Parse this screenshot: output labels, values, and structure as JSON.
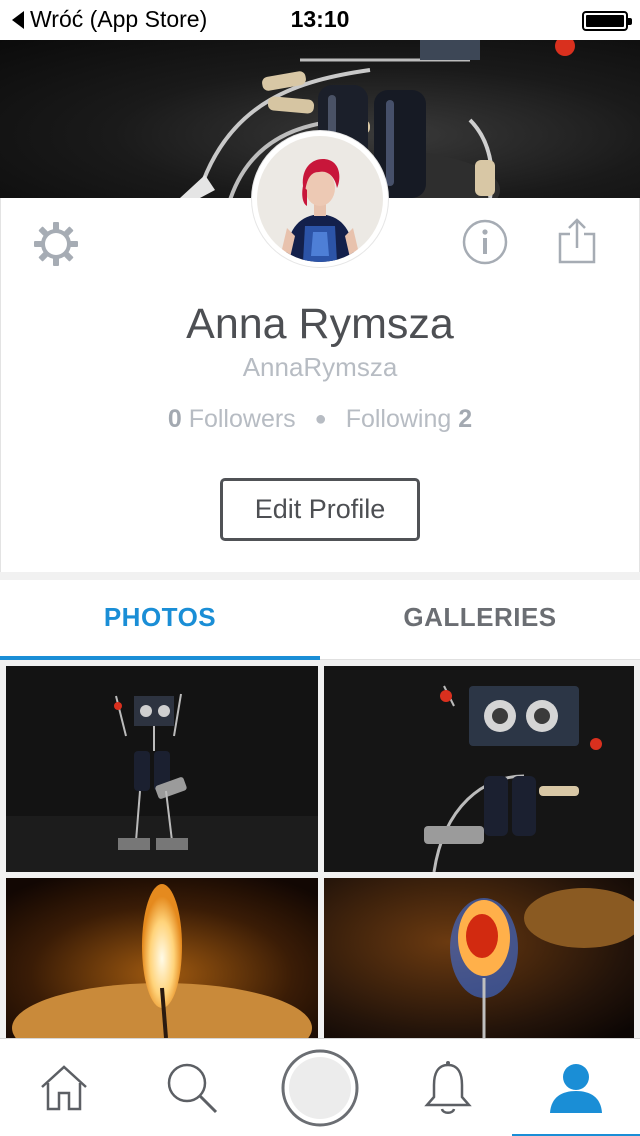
{
  "status_bar": {
    "back_label": "Wróć (App Store)",
    "time": "13:10"
  },
  "profile": {
    "name": "Anna Rymsza",
    "username": "AnnaRymsza",
    "followers_count": "0",
    "followers_label": "Followers",
    "following_label": "Following",
    "following_count": "2",
    "edit_button": "Edit Profile"
  },
  "tabs": [
    {
      "label": "PHOTOS",
      "active": true
    },
    {
      "label": "GALLERIES",
      "active": false
    }
  ],
  "icons": {
    "settings": "gear-icon",
    "info": "info-icon",
    "share": "share-icon",
    "home": "home-icon",
    "search": "search-icon",
    "upload": "camera-shutter-icon",
    "notifications": "bell-icon",
    "profile": "person-icon"
  },
  "colors": {
    "accent": "#1a8ed6",
    "text_dark": "#4d4f53",
    "text_muted": "#b7bcc3",
    "icon_gray": "#9aa0a8"
  }
}
